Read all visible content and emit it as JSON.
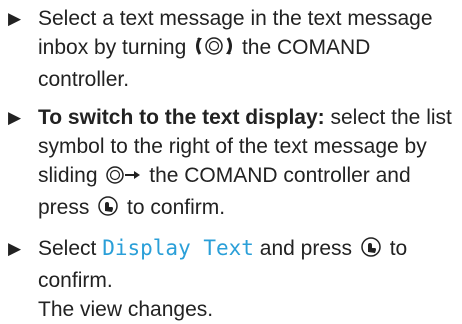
{
  "steps": [
    {
      "marker": "▶",
      "before": "Select a text message in the text message inbox by turning",
      "icon": "turn-controller-icon",
      "after": "the COMAND controller."
    },
    {
      "marker": "▶",
      "lead": "To switch to the text display:",
      "before": " select the list symbol to the right of the text message by sliding",
      "icon": "slide-right-controller-icon",
      "middle": "the COMAND controller and press",
      "icon2": "press-controller-icon",
      "after": "to confirm."
    },
    {
      "marker": "▶",
      "before": "Select",
      "menu_item": "Display Text",
      "middle": "and press",
      "icon": "press-controller-icon",
      "after": "to confirm.",
      "result": "The view changes."
    }
  ],
  "colors": {
    "text": "#222222",
    "menu_item": "#2a9fd8"
  }
}
